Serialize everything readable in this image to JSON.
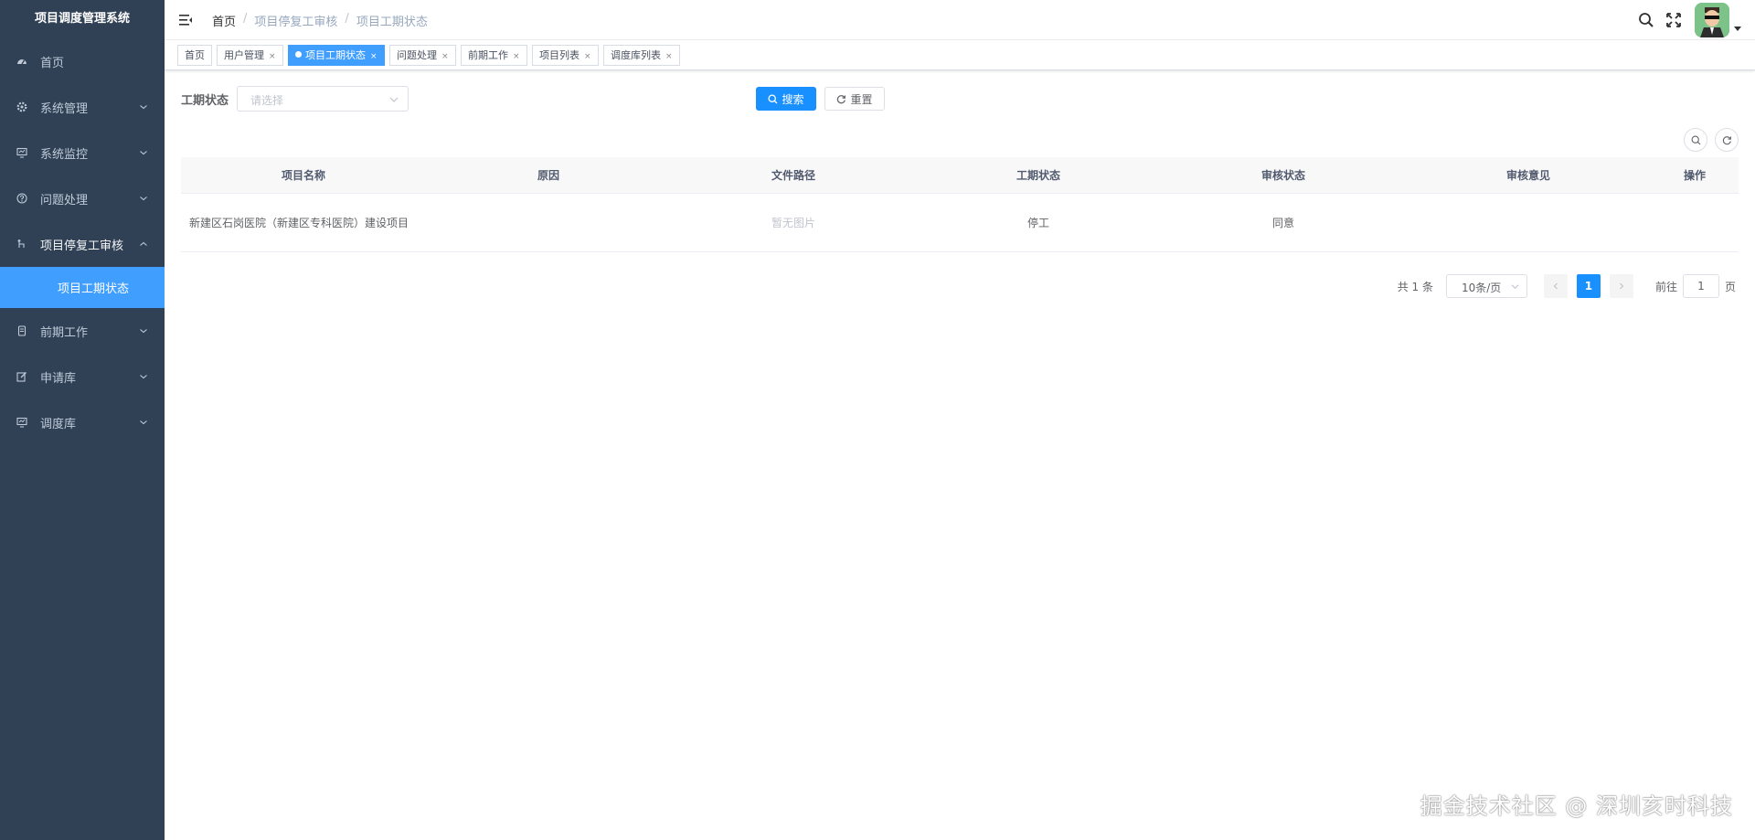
{
  "app": {
    "title": "项目调度管理系统"
  },
  "sidebar": {
    "items": [
      {
        "label": "首页",
        "icon": "dashboard-icon",
        "hasChildren": false
      },
      {
        "label": "系统管理",
        "icon": "gear-icon",
        "hasChildren": true
      },
      {
        "label": "系统监控",
        "icon": "monitor-icon",
        "hasChildren": true
      },
      {
        "label": "问题处理",
        "icon": "question-icon",
        "hasChildren": true
      },
      {
        "label": "项目停复工审核",
        "icon": "flow-icon",
        "hasChildren": true,
        "open": true
      },
      {
        "label": "前期工作",
        "icon": "document-icon",
        "hasChildren": true
      },
      {
        "label": "申请库",
        "icon": "edit-icon",
        "hasChildren": true
      },
      {
        "label": "调度库",
        "icon": "monitor-icon",
        "hasChildren": true
      }
    ],
    "active_sub": "项目工期状态"
  },
  "breadcrumb": {
    "home": "首页",
    "level1": "项目停复工审核",
    "level2": "项目工期状态",
    "sep": "/"
  },
  "tags": [
    {
      "label": "首页",
      "active": false,
      "closable": false
    },
    {
      "label": "用户管理",
      "active": false,
      "closable": true
    },
    {
      "label": "项目工期状态",
      "active": true,
      "closable": true
    },
    {
      "label": "问题处理",
      "active": false,
      "closable": true
    },
    {
      "label": "前期工作",
      "active": false,
      "closable": true
    },
    {
      "label": "项目列表",
      "active": false,
      "closable": true
    },
    {
      "label": "调度库列表",
      "active": false,
      "closable": true
    }
  ],
  "close_glyph": "×",
  "filter": {
    "label": "工期状态",
    "placeholder": "请选择",
    "search_label": "搜索",
    "reset_label": "重置"
  },
  "table": {
    "headers": [
      "项目名称",
      "原因",
      "文件路径",
      "工期状态",
      "审核状态",
      "审核意见",
      "操作"
    ],
    "rows": [
      {
        "name": "新建区石岗医院（新建区专科医院）建设项目",
        "reason": "",
        "file": "暂无图片",
        "period_status": "停工",
        "audit_status": "同意",
        "audit_opinion": "",
        "action": ""
      }
    ]
  },
  "pagination": {
    "total": "共 1 条",
    "page_size": "10条/页",
    "current_page": "1",
    "goto_label": "前往",
    "goto_value": "1",
    "page_suffix": "页"
  },
  "watermark": "掘金技术社区 @ 深圳亥时科技",
  "colors": {
    "sidebar_bg": "#304156",
    "primary": "#1890ff",
    "active_menu": "#409eff"
  }
}
